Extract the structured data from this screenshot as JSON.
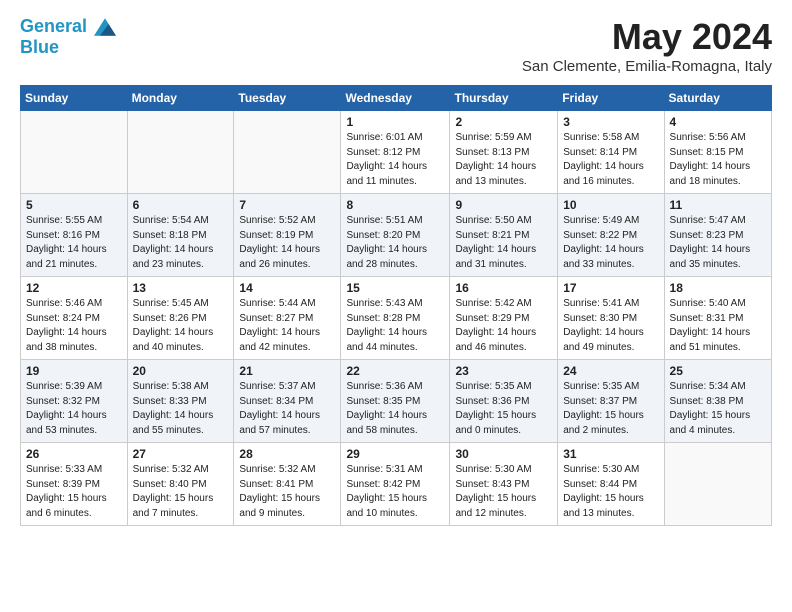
{
  "header": {
    "logo_line1": "General",
    "logo_line2": "Blue",
    "month_title": "May 2024",
    "location": "San Clemente, Emilia-Romagna, Italy"
  },
  "days_of_week": [
    "Sunday",
    "Monday",
    "Tuesday",
    "Wednesday",
    "Thursday",
    "Friday",
    "Saturday"
  ],
  "weeks": [
    [
      {
        "day": "",
        "info": ""
      },
      {
        "day": "",
        "info": ""
      },
      {
        "day": "",
        "info": ""
      },
      {
        "day": "1",
        "info": "Sunrise: 6:01 AM\nSunset: 8:12 PM\nDaylight: 14 hours\nand 11 minutes."
      },
      {
        "day": "2",
        "info": "Sunrise: 5:59 AM\nSunset: 8:13 PM\nDaylight: 14 hours\nand 13 minutes."
      },
      {
        "day": "3",
        "info": "Sunrise: 5:58 AM\nSunset: 8:14 PM\nDaylight: 14 hours\nand 16 minutes."
      },
      {
        "day": "4",
        "info": "Sunrise: 5:56 AM\nSunset: 8:15 PM\nDaylight: 14 hours\nand 18 minutes."
      }
    ],
    [
      {
        "day": "5",
        "info": "Sunrise: 5:55 AM\nSunset: 8:16 PM\nDaylight: 14 hours\nand 21 minutes."
      },
      {
        "day": "6",
        "info": "Sunrise: 5:54 AM\nSunset: 8:18 PM\nDaylight: 14 hours\nand 23 minutes."
      },
      {
        "day": "7",
        "info": "Sunrise: 5:52 AM\nSunset: 8:19 PM\nDaylight: 14 hours\nand 26 minutes."
      },
      {
        "day": "8",
        "info": "Sunrise: 5:51 AM\nSunset: 8:20 PM\nDaylight: 14 hours\nand 28 minutes."
      },
      {
        "day": "9",
        "info": "Sunrise: 5:50 AM\nSunset: 8:21 PM\nDaylight: 14 hours\nand 31 minutes."
      },
      {
        "day": "10",
        "info": "Sunrise: 5:49 AM\nSunset: 8:22 PM\nDaylight: 14 hours\nand 33 minutes."
      },
      {
        "day": "11",
        "info": "Sunrise: 5:47 AM\nSunset: 8:23 PM\nDaylight: 14 hours\nand 35 minutes."
      }
    ],
    [
      {
        "day": "12",
        "info": "Sunrise: 5:46 AM\nSunset: 8:24 PM\nDaylight: 14 hours\nand 38 minutes."
      },
      {
        "day": "13",
        "info": "Sunrise: 5:45 AM\nSunset: 8:26 PM\nDaylight: 14 hours\nand 40 minutes."
      },
      {
        "day": "14",
        "info": "Sunrise: 5:44 AM\nSunset: 8:27 PM\nDaylight: 14 hours\nand 42 minutes."
      },
      {
        "day": "15",
        "info": "Sunrise: 5:43 AM\nSunset: 8:28 PM\nDaylight: 14 hours\nand 44 minutes."
      },
      {
        "day": "16",
        "info": "Sunrise: 5:42 AM\nSunset: 8:29 PM\nDaylight: 14 hours\nand 46 minutes."
      },
      {
        "day": "17",
        "info": "Sunrise: 5:41 AM\nSunset: 8:30 PM\nDaylight: 14 hours\nand 49 minutes."
      },
      {
        "day": "18",
        "info": "Sunrise: 5:40 AM\nSunset: 8:31 PM\nDaylight: 14 hours\nand 51 minutes."
      }
    ],
    [
      {
        "day": "19",
        "info": "Sunrise: 5:39 AM\nSunset: 8:32 PM\nDaylight: 14 hours\nand 53 minutes."
      },
      {
        "day": "20",
        "info": "Sunrise: 5:38 AM\nSunset: 8:33 PM\nDaylight: 14 hours\nand 55 minutes."
      },
      {
        "day": "21",
        "info": "Sunrise: 5:37 AM\nSunset: 8:34 PM\nDaylight: 14 hours\nand 57 minutes."
      },
      {
        "day": "22",
        "info": "Sunrise: 5:36 AM\nSunset: 8:35 PM\nDaylight: 14 hours\nand 58 minutes."
      },
      {
        "day": "23",
        "info": "Sunrise: 5:35 AM\nSunset: 8:36 PM\nDaylight: 15 hours\nand 0 minutes."
      },
      {
        "day": "24",
        "info": "Sunrise: 5:35 AM\nSunset: 8:37 PM\nDaylight: 15 hours\nand 2 minutes."
      },
      {
        "day": "25",
        "info": "Sunrise: 5:34 AM\nSunset: 8:38 PM\nDaylight: 15 hours\nand 4 minutes."
      }
    ],
    [
      {
        "day": "26",
        "info": "Sunrise: 5:33 AM\nSunset: 8:39 PM\nDaylight: 15 hours\nand 6 minutes."
      },
      {
        "day": "27",
        "info": "Sunrise: 5:32 AM\nSunset: 8:40 PM\nDaylight: 15 hours\nand 7 minutes."
      },
      {
        "day": "28",
        "info": "Sunrise: 5:32 AM\nSunset: 8:41 PM\nDaylight: 15 hours\nand 9 minutes."
      },
      {
        "day": "29",
        "info": "Sunrise: 5:31 AM\nSunset: 8:42 PM\nDaylight: 15 hours\nand 10 minutes."
      },
      {
        "day": "30",
        "info": "Sunrise: 5:30 AM\nSunset: 8:43 PM\nDaylight: 15 hours\nand 12 minutes."
      },
      {
        "day": "31",
        "info": "Sunrise: 5:30 AM\nSunset: 8:44 PM\nDaylight: 15 hours\nand 13 minutes."
      },
      {
        "day": "",
        "info": ""
      }
    ]
  ]
}
